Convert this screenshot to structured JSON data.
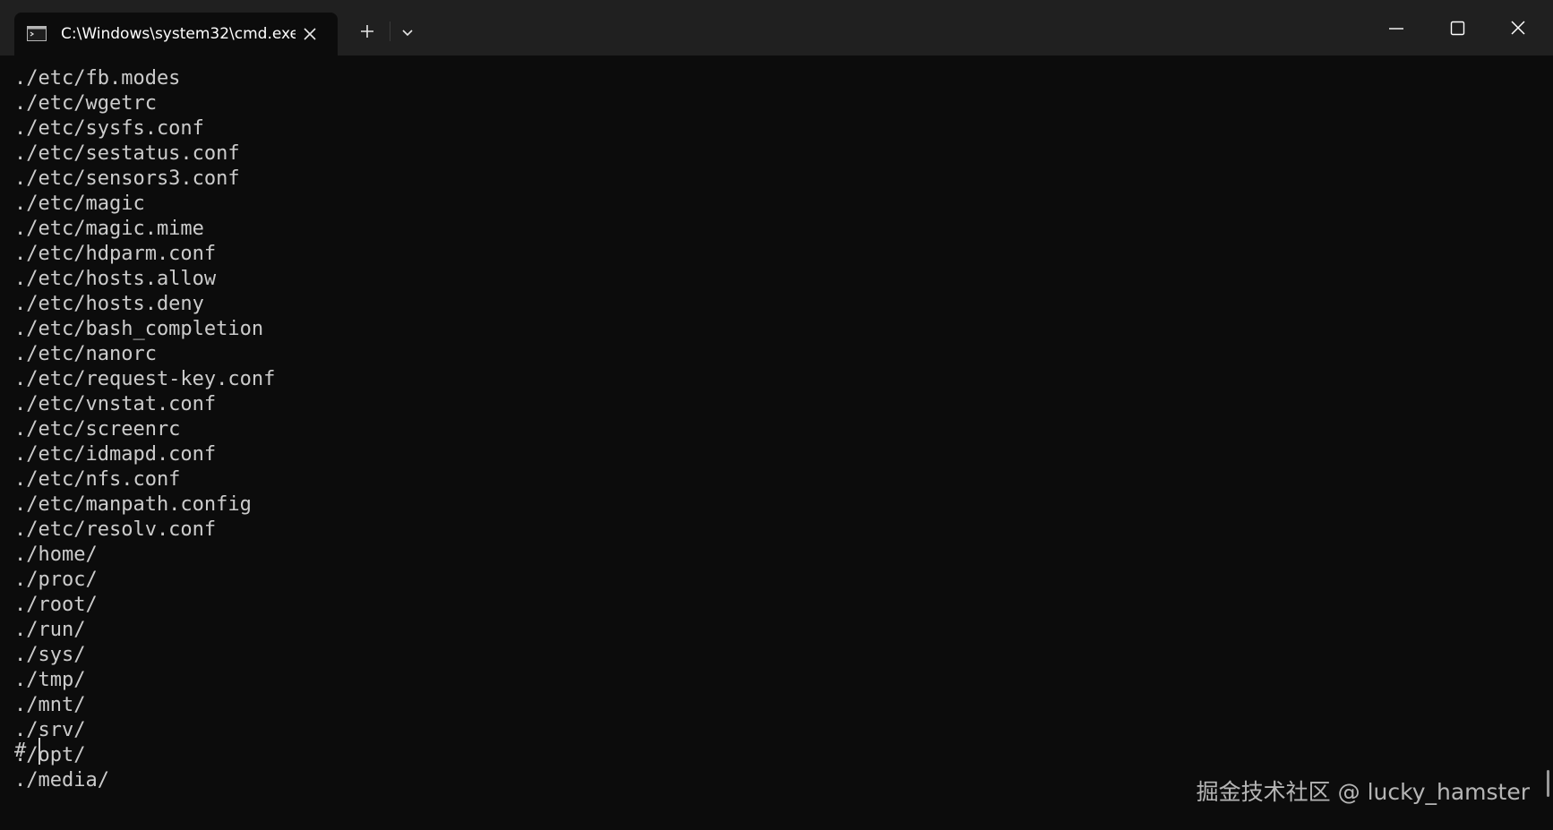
{
  "window": {
    "tab_title": "C:\\Windows\\system32\\cmd.exe",
    "icons": {
      "tab": "console-icon",
      "tab_close": "close-icon",
      "new_tab": "plus-icon",
      "dropdown": "chevron-down-icon",
      "minimize": "minimize-icon",
      "maximize": "maximize-icon",
      "close": "close-icon"
    }
  },
  "terminal": {
    "lines": [
      "./etc/fb.modes",
      "./etc/wgetrc",
      "./etc/sysfs.conf",
      "./etc/sestatus.conf",
      "./etc/sensors3.conf",
      "./etc/magic",
      "./etc/magic.mime",
      "./etc/hdparm.conf",
      "./etc/hosts.allow",
      "./etc/hosts.deny",
      "./etc/bash_completion",
      "./etc/nanorc",
      "./etc/request-key.conf",
      "./etc/vnstat.conf",
      "./etc/screenrc",
      "./etc/idmapd.conf",
      "./etc/nfs.conf",
      "./etc/manpath.config",
      "./etc/resolv.conf",
      "./home/",
      "./proc/",
      "./root/",
      "./run/",
      "./sys/",
      "./tmp/",
      "./mnt/",
      "./srv/",
      "./opt/",
      "./media/"
    ],
    "prompt": "#"
  },
  "watermark": "掘金技术社区 @ lucky_hamster",
  "colors": {
    "background": "#0c0c0c",
    "titlebar": "#202020",
    "text": "#cccccc"
  }
}
